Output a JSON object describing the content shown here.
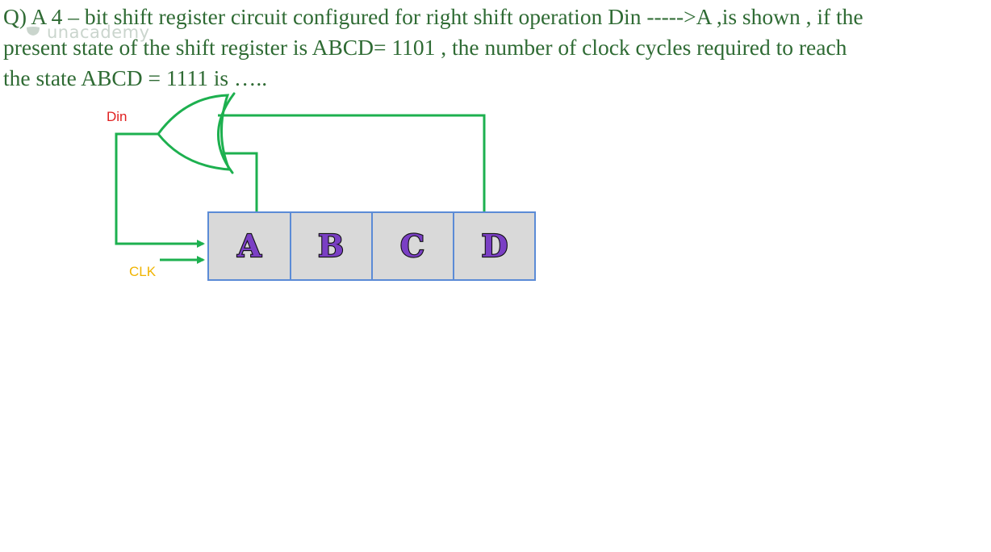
{
  "question": {
    "lines": [
      "Q) A 4 – bit shift register circuit configured for right shift operation Din ----->A ,is shown , if the",
      "present state of the shift register is ABCD= 1101 , the number of clock cycles required to reach",
      "the state ABCD = 1111 is ….."
    ]
  },
  "watermark": {
    "text": "unacademy",
    "icon": "unacademy-logo-icon"
  },
  "circuit": {
    "input_label": "Din",
    "clock_label": "CLK",
    "gate": "xor-gate",
    "cells": [
      "A",
      "B",
      "C",
      "D"
    ]
  },
  "colors": {
    "question_text": "#2f6b34",
    "wire": "#1db04f",
    "din_label": "#e02020",
    "clk_label": "#f0b400",
    "cell_fill": "#d9d9d9",
    "cell_border": "#5b8bd6",
    "cell_letter": "#7a3fc4"
  }
}
